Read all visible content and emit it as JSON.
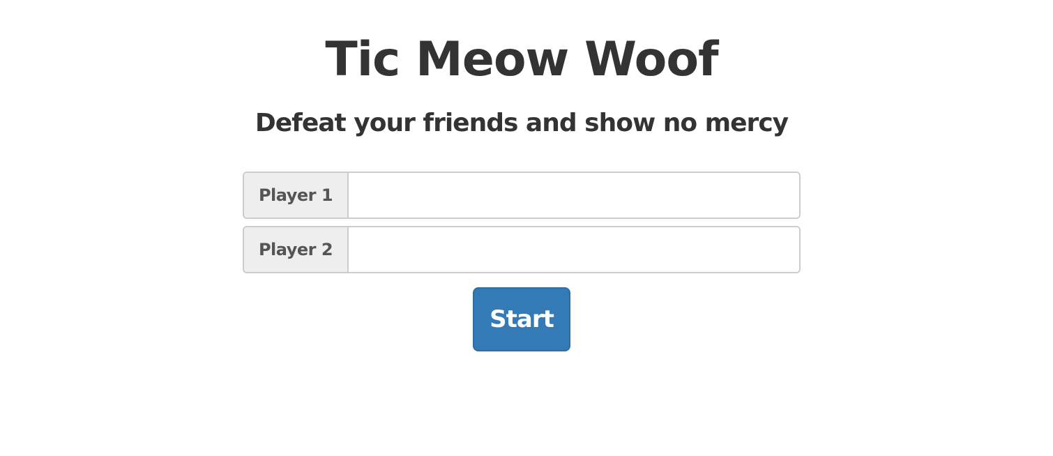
{
  "header": {
    "title": "Tic Meow Woof",
    "subtitle": "Defeat your friends and show no mercy"
  },
  "form": {
    "player1": {
      "label": "Player 1",
      "value": "",
      "placeholder": ""
    },
    "player2": {
      "label": "Player 2",
      "value": "",
      "placeholder": ""
    },
    "start_label": "Start"
  },
  "colors": {
    "text": "#333333",
    "addon_background": "#eeeeee",
    "border": "#cccccc",
    "button_background": "#337ab7",
    "button_text": "#ffffff"
  }
}
